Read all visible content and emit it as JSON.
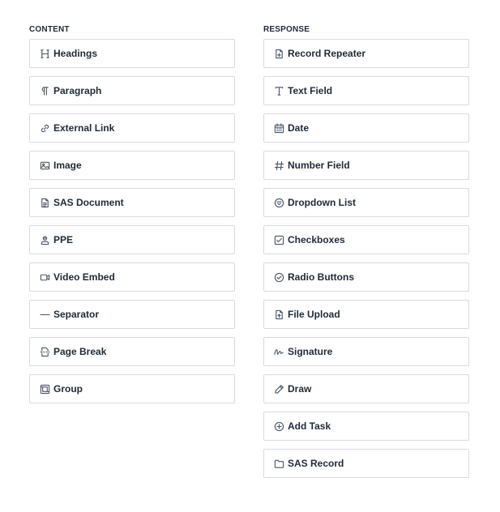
{
  "content": {
    "title": "CONTENT",
    "items": [
      {
        "label": "Headings",
        "icon": "heading-icon"
      },
      {
        "label": "Paragraph",
        "icon": "paragraph-icon"
      },
      {
        "label": "External Link",
        "icon": "link-icon"
      },
      {
        "label": "Image",
        "icon": "image-icon"
      },
      {
        "label": "SAS Document",
        "icon": "document-icon"
      },
      {
        "label": "PPE",
        "icon": "person-icon"
      },
      {
        "label": "Video Embed",
        "icon": "video-icon"
      },
      {
        "label": "Separator",
        "icon": "separator-icon"
      },
      {
        "label": "Page Break",
        "icon": "page-break-icon"
      },
      {
        "label": "Group",
        "icon": "group-icon"
      }
    ]
  },
  "response": {
    "title": "RESPONSE",
    "items": [
      {
        "label": "Record Repeater",
        "icon": "file-plus-icon"
      },
      {
        "label": "Text Field",
        "icon": "text-icon"
      },
      {
        "label": "Date",
        "icon": "calendar-icon"
      },
      {
        "label": "Number Field",
        "icon": "hash-icon"
      },
      {
        "label": "Dropdown List",
        "icon": "dropdown-icon"
      },
      {
        "label": "Checkboxes",
        "icon": "checkbox-icon"
      },
      {
        "label": "Radio Buttons",
        "icon": "radio-check-icon"
      },
      {
        "label": "File Upload",
        "icon": "file-upload-icon"
      },
      {
        "label": "Signature",
        "icon": "signature-icon"
      },
      {
        "label": "Draw",
        "icon": "pencil-icon"
      },
      {
        "label": "Add Task",
        "icon": "plus-circle-icon"
      },
      {
        "label": "SAS Record",
        "icon": "folder-icon"
      }
    ]
  }
}
